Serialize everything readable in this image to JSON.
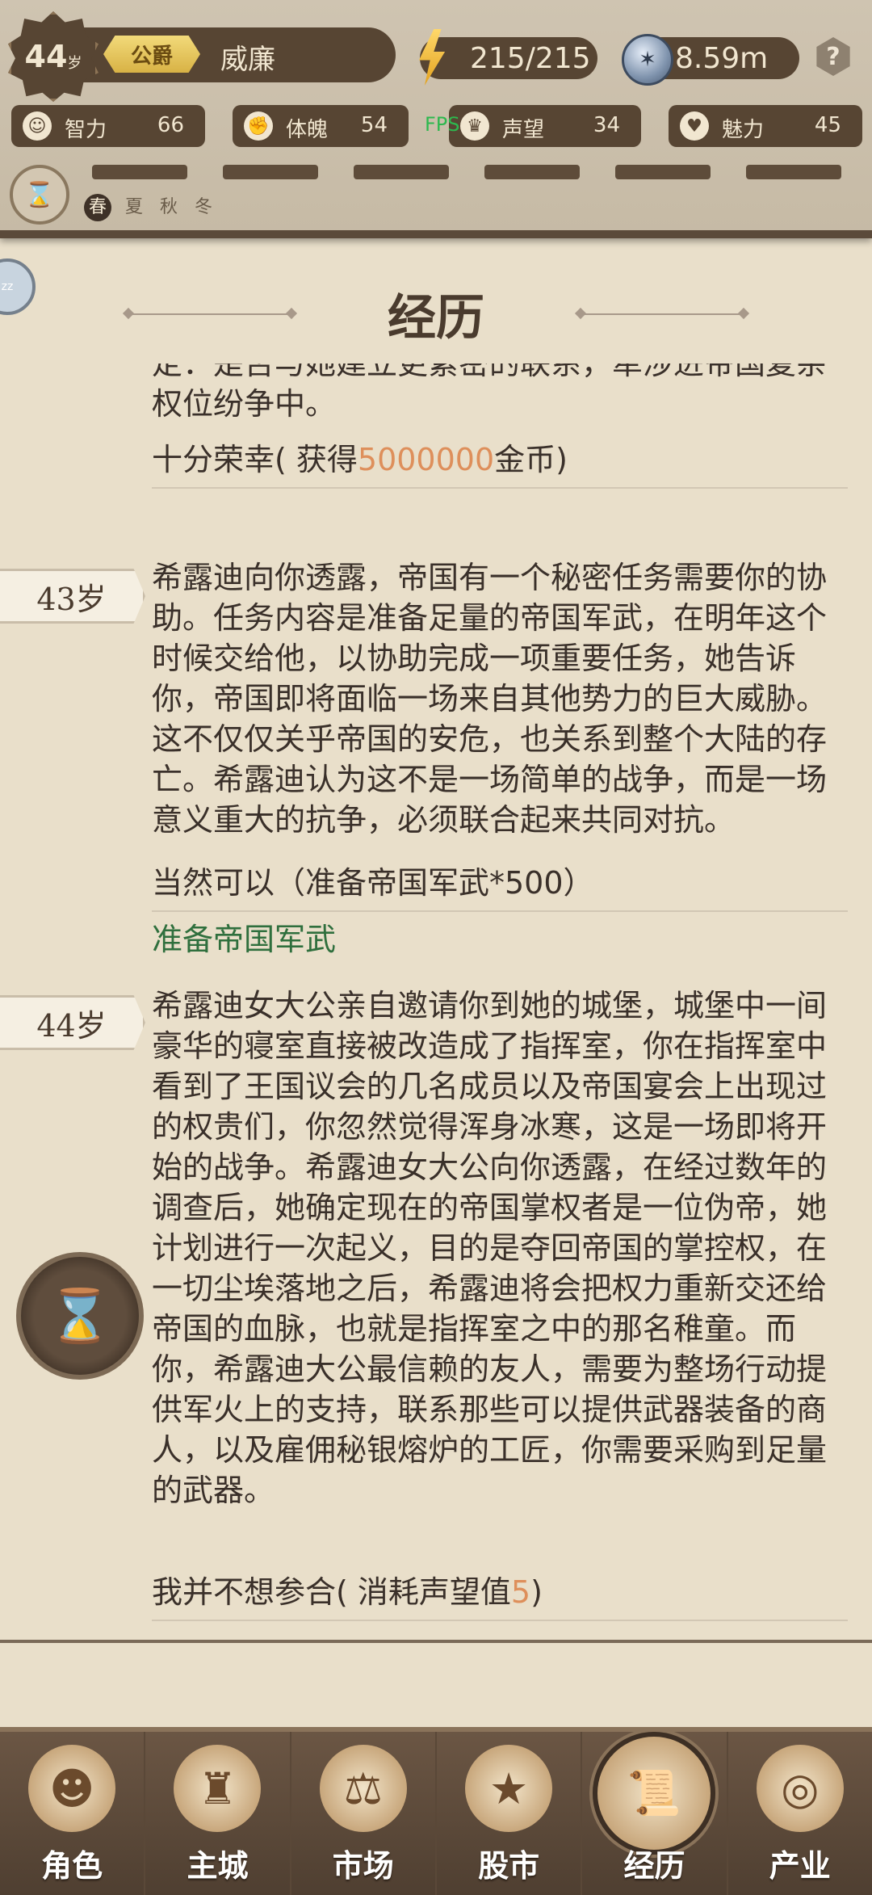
{
  "header": {
    "age": "44",
    "age_unit": "岁",
    "title": "公爵",
    "name": "威廉",
    "energy": "215/215",
    "money": "8.59m",
    "help": "?",
    "stats": [
      {
        "label": "智力",
        "value": "66",
        "icon": "brain-icon"
      },
      {
        "label": "体魄",
        "value": "54",
        "icon": "muscle-icon"
      },
      {
        "label": "声望",
        "value": "34",
        "icon": "crown-icon"
      },
      {
        "label": "魅力",
        "value": "45",
        "icon": "heartbeat-icon"
      }
    ],
    "fps": "FPS",
    "seasons": [
      "春",
      "夏",
      "秋",
      "冬"
    ],
    "active_season": "春"
  },
  "main": {
    "section_title": "经历",
    "entries": [
      {
        "age_label": "",
        "text": "定：是否与她建立更紧密的联系，牵涉进帝国复杂权位纷争中。",
        "choice_prefix": "十分荣幸( 获得",
        "choice_highlight": "5000000",
        "choice_suffix": "金币)",
        "result": ""
      },
      {
        "age_label": "43岁",
        "text": "希露迪向你透露，帝国有一个秘密任务需要你的协助。任务内容是准备足量的帝国军武，在明年这个时候交给他，以协助完成一项重要任务，她告诉你，帝国即将面临一场来自其他势力的巨大威胁。这不仅仅关乎帝国的安危，也关系到整个大陆的存亡。希露迪认为这不是一场简单的战争，而是一场意义重大的抗争，必须联合起来共同对抗。",
        "choice_prefix": "当然可以（准备帝国军武*500）",
        "choice_highlight": "",
        "choice_suffix": "",
        "result": "准备帝国军武"
      },
      {
        "age_label": "44岁",
        "text": "希露迪女大公亲自邀请你到她的城堡，城堡中一间豪华的寝室直接被改造成了指挥室，你在指挥室中看到了王国议会的几名成员以及帝国宴会上出现过的权贵们，你忽然觉得浑身冰寒，这是一场即将开始的战争。希露迪女大公向你透露，在经过数年的调查后，她确定现在的帝国掌权者是一位伪帝，她计划进行一次起义，目的是夺回帝国的掌控权，在一切尘埃落地之后，希露迪将会把权力重新交还给帝国的血脉，也就是指挥室之中的那名稚童。而你，希露迪大公最信赖的友人，需要为整场行动提供军火上的支持，联系那些可以提供武器装备的商人，以及雇佣秘银熔炉的工匠，你需要采购到足量的武器。",
        "choice_prefix": "我并不想参合( 消耗声望值",
        "choice_highlight": "5",
        "choice_suffix": ")",
        "result": ""
      }
    ]
  },
  "nav": {
    "items": [
      {
        "label": "角色",
        "icon": "character-icon"
      },
      {
        "label": "主城",
        "icon": "castle-icon"
      },
      {
        "label": "市场",
        "icon": "scales-icon"
      },
      {
        "label": "股市",
        "icon": "stock-star-icon"
      },
      {
        "label": "经历",
        "icon": "scroll-icon"
      },
      {
        "label": "产业",
        "icon": "coins-icon"
      }
    ],
    "active": "经历"
  },
  "colors": {
    "header_bg": "#c6baa5",
    "panel_dark": "#574533",
    "paper": "#e9dfca",
    "highlight_orange": "#de8f5b",
    "result_green": "#2f6f3d",
    "fps_green": "#2db84e"
  }
}
